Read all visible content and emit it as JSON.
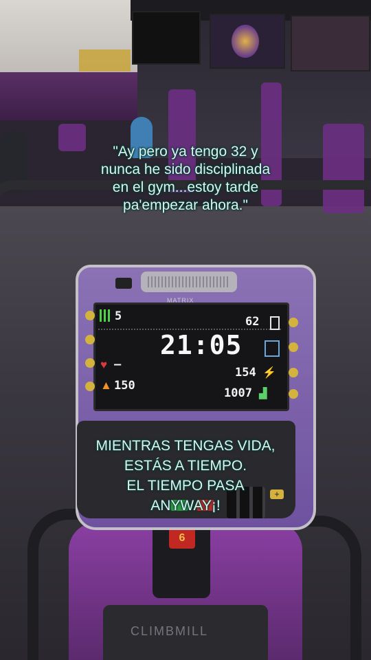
{
  "captions": {
    "quote": [
      "\"Ay pero ya tengo 32 y",
      "nunca he sido disciplinada",
      "en el gym...estoy tarde",
      "pa'empezar ahora.\""
    ],
    "motto": [
      "MIENTRAS TENGAS VIDA,",
      "ESTÁS A TIEMPO.",
      "EL TIEMPO PASA",
      "ANYWAY¡!"
    ]
  },
  "console": {
    "brand": "MATRIX",
    "time": "21:05",
    "level": "5",
    "floors": "62",
    "heart_rate": "—",
    "calories": "150",
    "watts": "154",
    "steps": "1007",
    "key_number": "6"
  },
  "machine": {
    "brand": "CLIMBMILL"
  },
  "colors": {
    "caption_text": "#d8f5ef",
    "console_purple": "#7a5fa8",
    "gym_purple": "#6b2f83"
  }
}
